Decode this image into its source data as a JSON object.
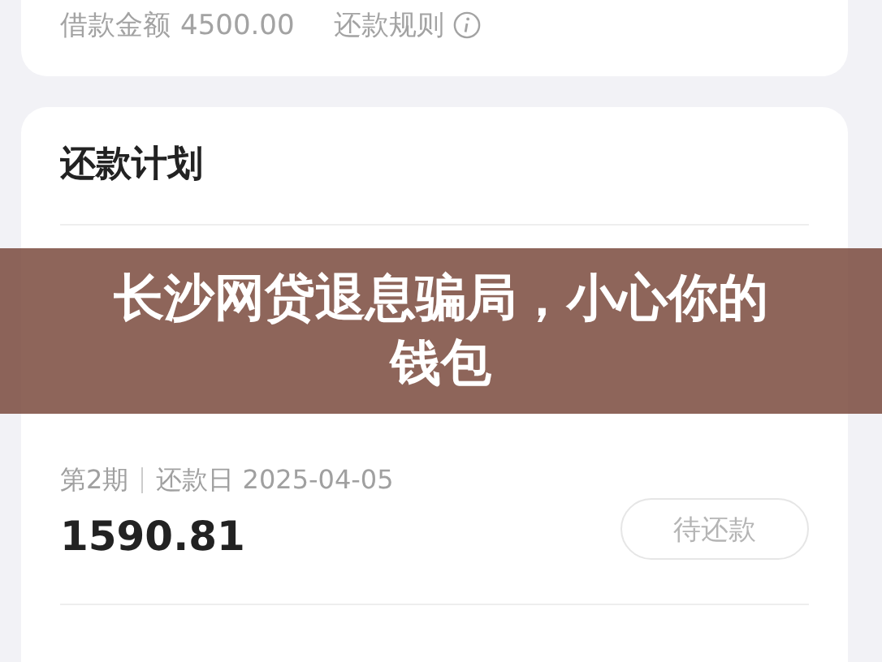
{
  "loan_summary": {
    "amount_label": "借款金额",
    "amount": "4500.00",
    "rules_link": "还款规则"
  },
  "plan": {
    "title": "还款计划",
    "rows": [
      {
        "period": "第2期",
        "due_label": "还款日",
        "due_date": "2025-04-05",
        "amount": "1590.81",
        "status": {
          "kind": "pending",
          "label": "待还款"
        }
      }
    ]
  },
  "overlay_title": "长沙网贷退息骗局，小心你的钱包"
}
